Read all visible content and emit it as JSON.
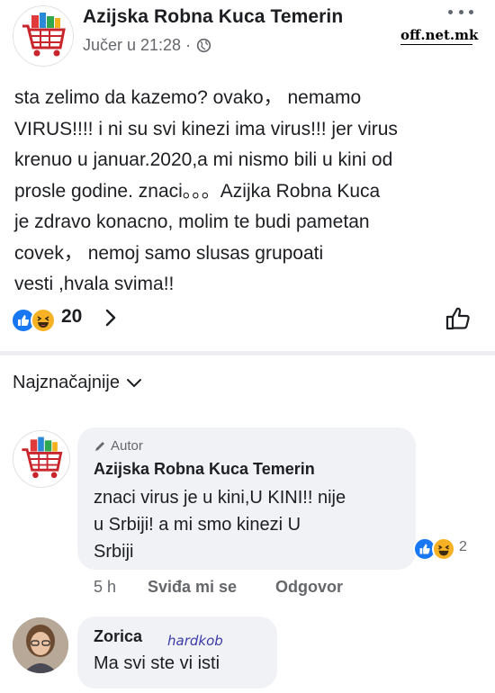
{
  "post": {
    "page_name": "Azijska Robna Kuca Temerin",
    "timestamp": "Jučer u 21:28 ·",
    "privacy_icon": "globe-icon",
    "more_icon": "more-options-icon",
    "watermark": "off.net.mk",
    "text": "sta zelimo da kazemo? ovako， nemamo\nVIRUS!!!! i ni su svi kinezi ima virus!!! jer virus\nkrenuo u januar.2020,a mi nismo bili u kini od\nprosle godine. znaci。。。Azijka Robna Kuca\nje zdravo konacno, molim te budi pametan\ncovek， nemoj samo slusas grupoati\nvesti ,hvala svima!!",
    "reactions": {
      "count": "20",
      "icons": [
        "like-reaction-icon",
        "haha-reaction-icon"
      ]
    }
  },
  "comments_sort": {
    "label": "Najznačajnije"
  },
  "comments": [
    {
      "author_badge": "Autor",
      "name": "Azijska Robna Kuca Temerin",
      "text": "znaci virus je u kini,U KINI!! nije\nu Srbiji! a mi smo kinezi U\nSrbiji",
      "reaction_count": "2",
      "time": "5 h",
      "like_label": "Sviđa mi se",
      "reply_label": "Odgovor"
    },
    {
      "name": "Zorica",
      "tag": "hardkob",
      "text": "Ma svi ste vi isti"
    }
  ],
  "colors": {
    "accent": "#1877f2",
    "haha": "#f7b125",
    "bubble": "#f0f2f5",
    "meta": "#65676b"
  }
}
